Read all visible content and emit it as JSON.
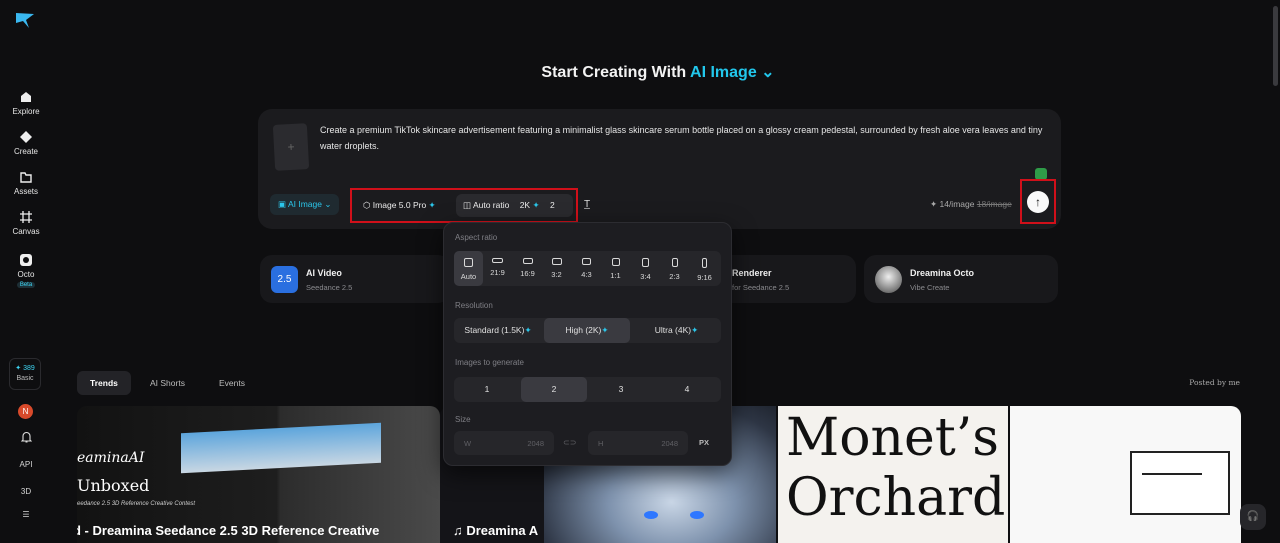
{
  "sidebar": {
    "items": [
      {
        "label": "Explore",
        "icon": "home-icon"
      },
      {
        "label": "Create",
        "icon": "diamond-icon"
      },
      {
        "label": "Assets",
        "icon": "folder-icon"
      },
      {
        "label": "Canvas",
        "icon": "canvas-icon"
      },
      {
        "label": "Octo",
        "icon": "octo-icon",
        "badge": "Beta"
      }
    ],
    "credits": {
      "amount": "389",
      "plan": "Basic"
    },
    "avatar_initial": "N",
    "api_label": "API",
    "three_d_label": "3D"
  },
  "header": {
    "title_prefix": "Start Creating With",
    "title_accent": "AI Image"
  },
  "prompt": {
    "text": "Create a premium TikTok skincare advertisement featuring a minimalist glass skincare serum bottle placed on a glossy cream pedestal, surrounded by fresh aloe vera leaves and tiny water droplets.",
    "mode": "AI Image",
    "model": "Image 5.0 Pro",
    "ratio": "Auto ratio",
    "resolution": "2K",
    "count": "2",
    "cost": "14/image",
    "cost_original": "18/image"
  },
  "tools": [
    {
      "name": "AI Video",
      "sub": "Seedance 2.5"
    },
    {
      "name": "Renderer",
      "sub": "for Seedance 2.5"
    },
    {
      "name": "Dreamina Octo",
      "sub": "Vibe Create"
    }
  ],
  "panel": {
    "aspect_label": "Aspect ratio",
    "ratios": [
      "Auto",
      "21:9",
      "16:9",
      "3:2",
      "4:3",
      "1:1",
      "3:4",
      "2:3",
      "9:16"
    ],
    "resolution_label": "Resolution",
    "resolutions": [
      "Standard (1.5K)",
      "High (2K)",
      "Ultra (4K)"
    ],
    "images_label": "Images to generate",
    "counts": [
      "1",
      "2",
      "3",
      "4"
    ],
    "size_label": "Size",
    "width_key": "W",
    "width_value": "2048",
    "height_key": "H",
    "height_value": "2048",
    "unit": "PX"
  },
  "tabs": [
    "Trends",
    "AI Shorts",
    "Events"
  ],
  "posted_by": "Posted by me",
  "gallery": {
    "card1_brand": "eaminaAI",
    "card1_title": "Unboxed",
    "card1_sub": "eedance 2.5 3D Reference Creative Contest",
    "card1_caption": "d - Dreamina Seedance 2.5 3D Reference Creative",
    "card2_caption": "♫ Dreamina A",
    "card4_line1": "Monet’s",
    "card4_line2": "Orchard"
  },
  "colors": {
    "accent": "#22c7ec",
    "highlight": "#d0101a",
    "background": "#0e0e10"
  }
}
